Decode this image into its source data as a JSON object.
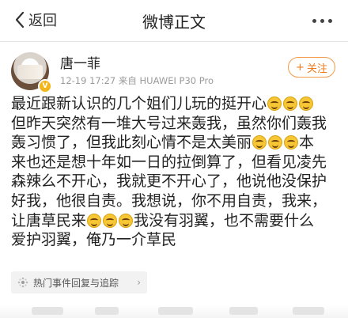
{
  "nav": {
    "back_label": "返回",
    "title": "微博正文"
  },
  "post": {
    "author": "唐一菲",
    "meta": "12-19 17:27  来自 HUAWEI P30 Pro",
    "follow_label": "关注",
    "emoji_name": "laugh-emoji",
    "lines": [
      {
        "segments": [
          {
            "t": "最近跟新认识的几个姐们儿玩的挺开心"
          },
          {
            "e": 3
          }
        ]
      },
      {
        "segments": [
          {
            "t": "但昨天突然有一堆大号过来轰我，虽然你们轰我"
          }
        ]
      },
      {
        "segments": [
          {
            "t": "轰习惯了，但我此刻心情不是太美丽"
          },
          {
            "e": 3
          },
          {
            "t": "本"
          }
        ]
      },
      {
        "segments": [
          {
            "t": "来也还是想十年如一日的拉倒算了，但看见凌先"
          }
        ]
      },
      {
        "segments": [
          {
            "t": "森辣么不开心，我就更不开心了，他说他没保护"
          }
        ]
      },
      {
        "segments": [
          {
            "t": "好我，他很自责。我想说，你不用自责，我来，"
          }
        ]
      },
      {
        "segments": [
          {
            "t": "让唐草民来"
          },
          {
            "e": 3
          },
          {
            "t": "我没有羽翼，也不需要什么"
          }
        ]
      },
      {
        "segments": [
          {
            "t": "爱护羽翼，俺乃一介草民"
          }
        ]
      }
    ]
  },
  "topic": {
    "label": "热门事件回复与追踪"
  }
}
